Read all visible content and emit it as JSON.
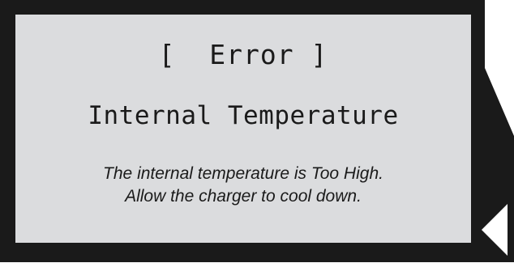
{
  "screen": {
    "title": "[  Error ]",
    "heading": "Internal Temperature",
    "message_lines": [
      "The internal temperature is Too High.",
      "Allow the charger to cool down."
    ]
  },
  "controls": {
    "back_icon": "left-triangle-arrow"
  },
  "colors": {
    "bezel": "#1a1a1a",
    "lcd_background": "#dbdcde",
    "text": "#1a1a1a"
  }
}
